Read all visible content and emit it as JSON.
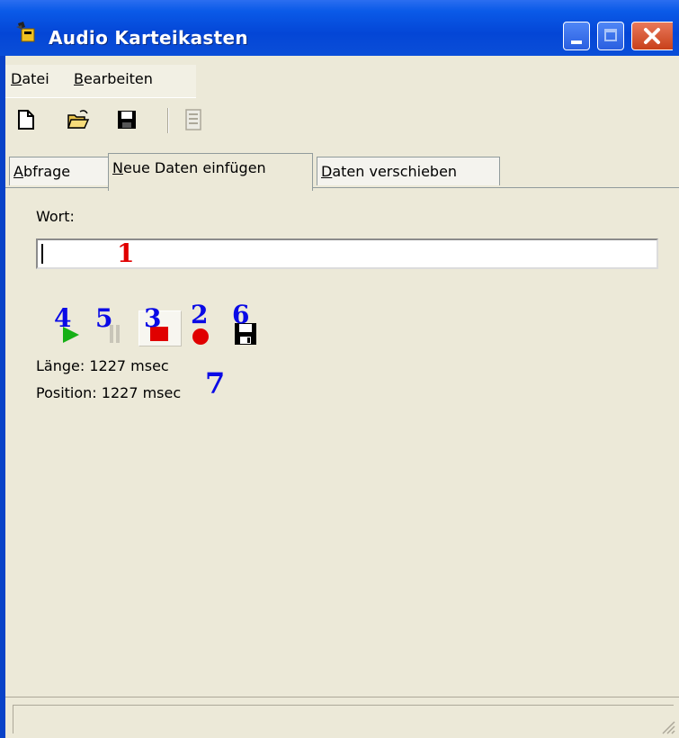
{
  "window": {
    "title": "Audio Karteikasten",
    "colors": {
      "titlebar": "#0a4ed8",
      "face": "#ece9d8",
      "close": "#d2522e"
    }
  },
  "menu": {
    "items": [
      {
        "accel": "D",
        "rest": "atei"
      },
      {
        "accel": "B",
        "rest": "earbeiten"
      }
    ]
  },
  "toolbar": {
    "icons": [
      "new-file-icon",
      "open-folder-icon",
      "save-disk-icon",
      "disabled-document-icon"
    ]
  },
  "tabs": [
    {
      "accel": "A",
      "rest": "bfrage",
      "active": false
    },
    {
      "accel": "N",
      "rest": "eue Daten einfügen",
      "active": true
    },
    {
      "accel": "D",
      "rest": "aten verschieben",
      "active": false
    }
  ],
  "panel": {
    "word_label": "Wort:",
    "word_value": "",
    "controls": [
      "play-icon",
      "pause-icon",
      "stop-icon",
      "record-icon",
      "save-icon"
    ],
    "length_text": "Länge: 1227 msec",
    "position_text": "Position: 1227 msec"
  },
  "annotations": [
    "1",
    "2",
    "3",
    "4",
    "5",
    "6",
    "7"
  ]
}
